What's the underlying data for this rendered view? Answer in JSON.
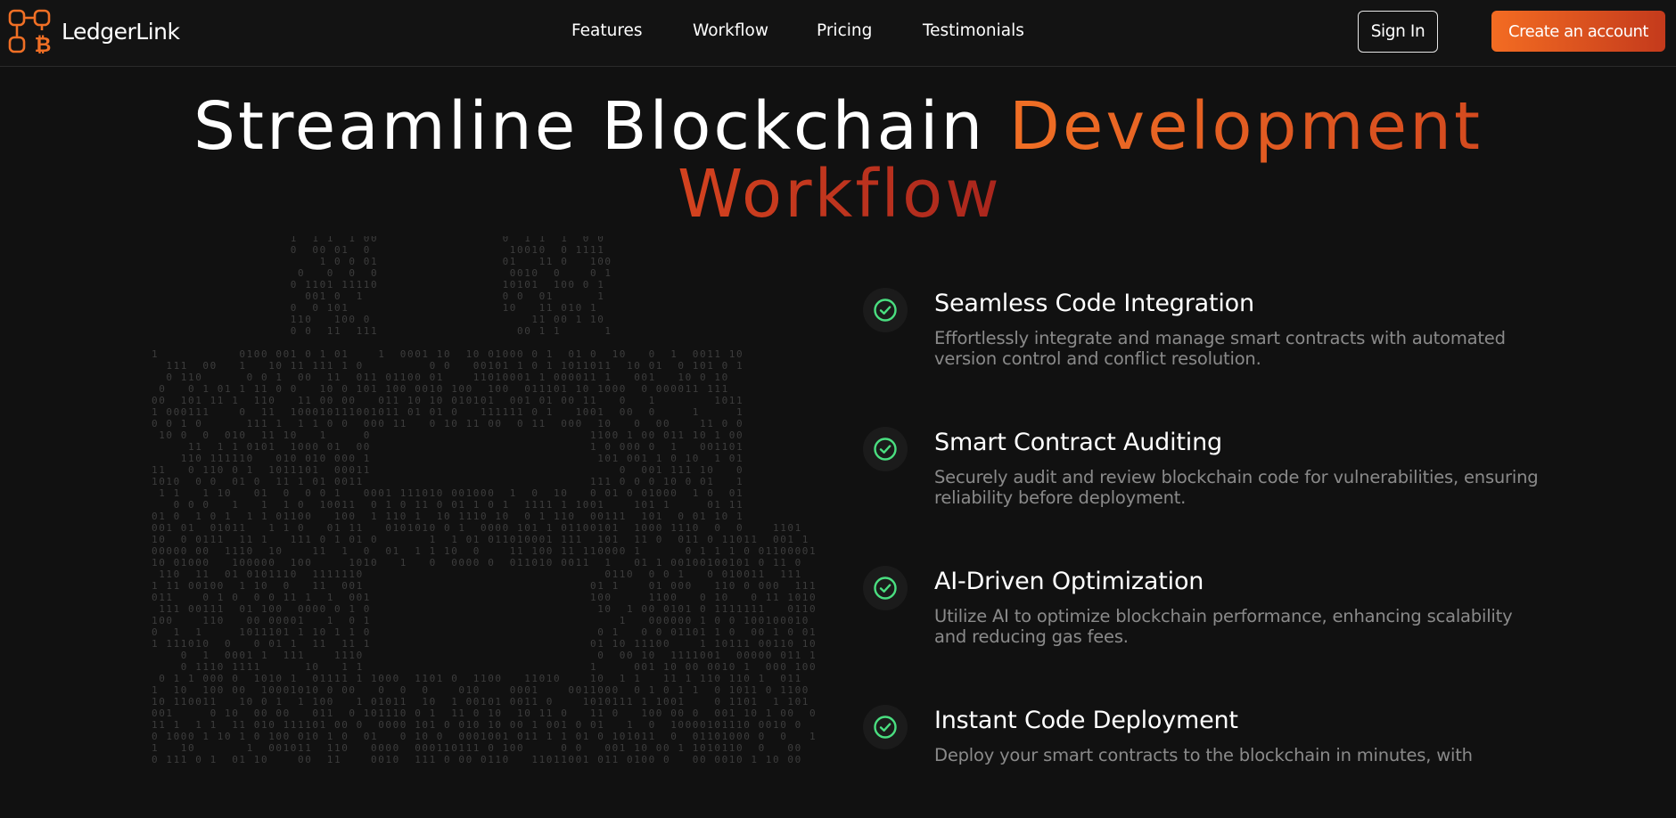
{
  "brand": {
    "name": "LedgerLink",
    "logo_icon": "bitcoin-network-logo-icon",
    "accent": "#f06f25"
  },
  "nav": {
    "links": [
      "Features",
      "Workflow",
      "Pricing",
      "Testimonials"
    ]
  },
  "header_actions": {
    "sign_in": "Sign In",
    "create_account": "Create an account"
  },
  "hero": {
    "title_white": "Streamline Blockchain ",
    "title_accent": "Development",
    "title_line2": "Workflow"
  },
  "features": [
    {
      "icon": "check-circle-icon",
      "title": "Seamless Code Integration",
      "description": "Effortlessly integrate and manage smart contracts with automated version control and conflict resolution."
    },
    {
      "icon": "check-circle-icon",
      "title": "Smart Contract Auditing",
      "description": "Securely audit and review blockchain code for vulnerabilities, ensuring reliability before deployment."
    },
    {
      "icon": "check-circle-icon",
      "title": "AI-Driven Optimization",
      "description": "Utilize AI to optimize blockchain performance, enhancing scalability and reducing gas fees."
    },
    {
      "icon": "check-circle-icon",
      "title": "Instant Code Deployment",
      "description": "Deploy your smart contracts to the blockchain in minutes, with"
    }
  ],
  "colors": {
    "background": "#111111",
    "accent_start": "#f36c22",
    "accent_end": "#c43a1c",
    "check_green": "#4ade80",
    "muted_text": "#8a8a8a"
  }
}
